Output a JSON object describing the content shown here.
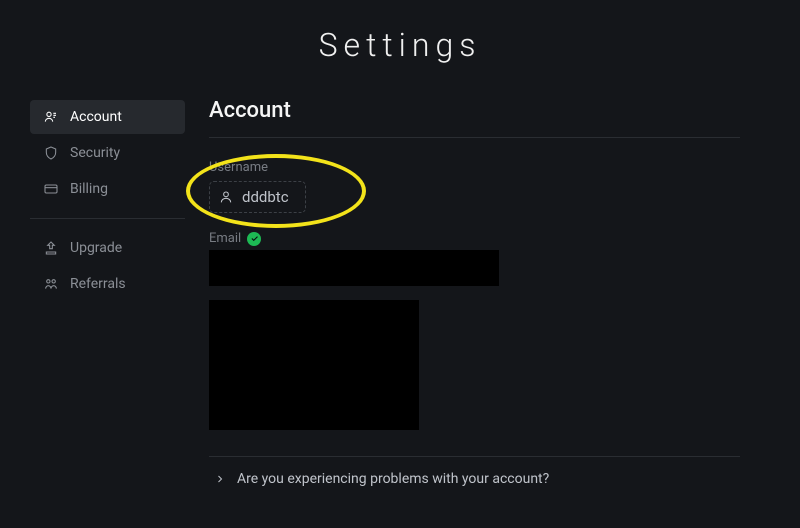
{
  "page": {
    "title": "Settings"
  },
  "sidebar": {
    "items": [
      {
        "label": "Account",
        "icon": "user-group"
      },
      {
        "label": "Security",
        "icon": "shield"
      },
      {
        "label": "Billing",
        "icon": "card"
      }
    ],
    "secondary": [
      {
        "label": "Upgrade",
        "icon": "upgrade"
      },
      {
        "label": "Referrals",
        "icon": "referrals"
      }
    ]
  },
  "account": {
    "section_title": "Account",
    "username_label": "Username",
    "username_value": "dddbtc",
    "email_label": "Email",
    "email_verified": true,
    "troubleshoot": "Are you experiencing problems with your account?"
  },
  "colors": {
    "bg": "#14161a",
    "accent_highlight": "#f3e31a",
    "verified": "#1db954"
  }
}
